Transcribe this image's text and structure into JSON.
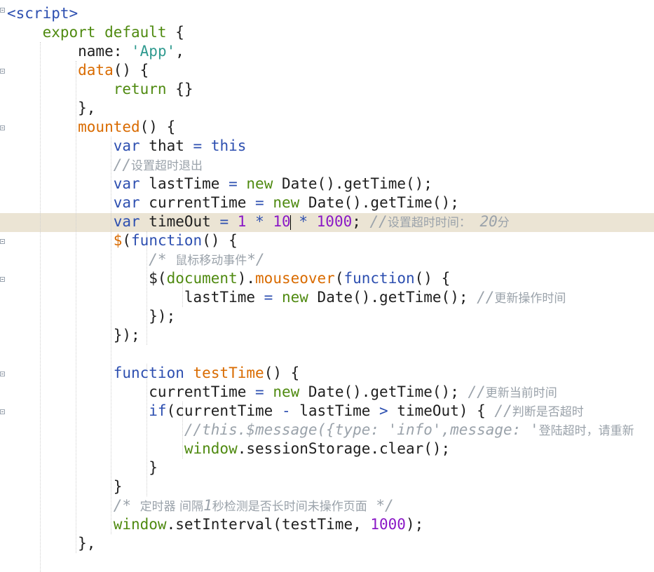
{
  "editor": {
    "highlighted_line": 12,
    "lines": [
      [
        {
          "c": "tag",
          "t": "<script>"
        }
      ],
      [
        {
          "c": "kw-g",
          "t": "    export default"
        },
        {
          "c": "",
          "t": " {"
        }
      ],
      [
        {
          "c": "",
          "t": "        name: "
        },
        {
          "c": "str",
          "t": "'App'"
        },
        {
          "c": "",
          "t": ","
        }
      ],
      [
        {
          "c": "kw-o",
          "t": "        data"
        },
        {
          "c": "",
          "t": "() {"
        }
      ],
      [
        {
          "c": "kw-g",
          "t": "            return"
        },
        {
          "c": "",
          "t": " {}"
        }
      ],
      [
        {
          "c": "",
          "t": "        },"
        }
      ],
      [
        {
          "c": "kw-o",
          "t": "        mounted"
        },
        {
          "c": "",
          "t": "() {"
        }
      ],
      [
        {
          "c": "kw-d",
          "t": "            var"
        },
        {
          "c": "",
          "t": " that "
        },
        {
          "c": "kw-d",
          "t": "="
        },
        {
          "c": "",
          "t": " "
        },
        {
          "c": "kw-d",
          "t": "this"
        }
      ],
      [
        {
          "c": "cm",
          "t": "            //"
        },
        {
          "c": "cm-cjk",
          "t": "设置超时退出"
        }
      ],
      [
        {
          "c": "kw-d",
          "t": "            var"
        },
        {
          "c": "",
          "t": " lastTime "
        },
        {
          "c": "kw-d",
          "t": "="
        },
        {
          "c": "",
          "t": " "
        },
        {
          "c": "kw-g",
          "t": "new"
        },
        {
          "c": "",
          "t": " Date().getTime();"
        }
      ],
      [
        {
          "c": "kw-d",
          "t": "            var"
        },
        {
          "c": "",
          "t": " currentTime "
        },
        {
          "c": "kw-d",
          "t": "="
        },
        {
          "c": "",
          "t": " "
        },
        {
          "c": "kw-g",
          "t": "new"
        },
        {
          "c": "",
          "t": " Date().getTime();"
        }
      ],
      [
        {
          "c": "kw-d",
          "t": "            var"
        },
        {
          "c": "",
          "t": " timeOut "
        },
        {
          "c": "kw-d",
          "t": "="
        },
        {
          "c": "",
          "t": " "
        },
        {
          "c": "kw-p",
          "t": "1"
        },
        {
          "c": "",
          "t": " "
        },
        {
          "c": "kw-d",
          "t": "*"
        },
        {
          "c": "",
          "t": " "
        },
        {
          "c": "kw-p",
          "t": "10"
        },
        {
          "c": "caret",
          "t": ""
        },
        {
          "c": "",
          "t": " "
        },
        {
          "c": "kw-d",
          "t": "*"
        },
        {
          "c": "",
          "t": " "
        },
        {
          "c": "kw-p",
          "t": "1000"
        },
        {
          "c": "",
          "t": "; "
        },
        {
          "c": "cm",
          "t": "//"
        },
        {
          "c": "cm-cjk",
          "t": "设置超时时间："
        },
        {
          "c": "cm",
          "t": " 20"
        },
        {
          "c": "cm-cjk",
          "t": "分"
        }
      ],
      [
        {
          "c": "kw-o",
          "t": "            $"
        },
        {
          "c": "",
          "t": "("
        },
        {
          "c": "kw-d",
          "t": "function"
        },
        {
          "c": "",
          "t": "() {"
        }
      ],
      [
        {
          "c": "cm",
          "t": "                /* "
        },
        {
          "c": "cm-cjk",
          "t": "鼠标移动事件"
        },
        {
          "c": "cm",
          "t": "*/"
        }
      ],
      [
        {
          "c": "",
          "t": "                $("
        },
        {
          "c": "kw-g",
          "t": "document"
        },
        {
          "c": "",
          "t": ")."
        },
        {
          "c": "kw-o",
          "t": "mouseover"
        },
        {
          "c": "",
          "t": "("
        },
        {
          "c": "kw-d",
          "t": "function"
        },
        {
          "c": "",
          "t": "() {"
        }
      ],
      [
        {
          "c": "",
          "t": "                    lastTime "
        },
        {
          "c": "kw-d",
          "t": "="
        },
        {
          "c": "",
          "t": " "
        },
        {
          "c": "kw-g",
          "t": "new"
        },
        {
          "c": "",
          "t": " Date().getTime(); "
        },
        {
          "c": "cm",
          "t": "//"
        },
        {
          "c": "cm-cjk",
          "t": "更新操作时间"
        }
      ],
      [
        {
          "c": "",
          "t": "                });"
        }
      ],
      [
        {
          "c": "",
          "t": "            });"
        }
      ],
      [
        {
          "c": "",
          "t": ""
        }
      ],
      [
        {
          "c": "kw-d",
          "t": "            function"
        },
        {
          "c": "",
          "t": " "
        },
        {
          "c": "kw-o",
          "t": "testTime"
        },
        {
          "c": "",
          "t": "() {"
        }
      ],
      [
        {
          "c": "",
          "t": "                currentTime "
        },
        {
          "c": "kw-d",
          "t": "="
        },
        {
          "c": "",
          "t": " "
        },
        {
          "c": "kw-g",
          "t": "new"
        },
        {
          "c": "",
          "t": " Date().getTime(); "
        },
        {
          "c": "cm",
          "t": "//"
        },
        {
          "c": "cm-cjk",
          "t": "更新当前时间"
        }
      ],
      [
        {
          "c": "kw-d",
          "t": "                if"
        },
        {
          "c": "",
          "t": "(currentTime "
        },
        {
          "c": "kw-d",
          "t": "-"
        },
        {
          "c": "",
          "t": " lastTime "
        },
        {
          "c": "kw-d",
          "t": ">"
        },
        {
          "c": "",
          "t": " timeOut) { "
        },
        {
          "c": "cm",
          "t": "//"
        },
        {
          "c": "cm-cjk",
          "t": "判断是否超时"
        }
      ],
      [
        {
          "c": "cm",
          "t": "                    //this.$message({type: 'info',message: '"
        },
        {
          "c": "cm-cjk",
          "t": "登陆超时，请重新"
        }
      ],
      [
        {
          "c": "kw-g",
          "t": "                    window"
        },
        {
          "c": "",
          "t": ".sessionStorage.clear();"
        }
      ],
      [
        {
          "c": "",
          "t": "                }"
        }
      ],
      [
        {
          "c": "",
          "t": "            }"
        }
      ],
      [
        {
          "c": "cm",
          "t": "            /* "
        },
        {
          "c": "cm-cjk",
          "t": "定时器 间隔"
        },
        {
          "c": "cm",
          "t": "1"
        },
        {
          "c": "cm-cjk",
          "t": "秒检测是否长时间未操作页面"
        },
        {
          "c": "cm",
          "t": " */"
        }
      ],
      [
        {
          "c": "kw-g",
          "t": "            window"
        },
        {
          "c": "",
          "t": ".setInterval(testTime, "
        },
        {
          "c": "kw-p",
          "t": "1000"
        },
        {
          "c": "",
          "t": ");"
        }
      ],
      [
        {
          "c": "",
          "t": "        },"
        }
      ]
    ]
  }
}
